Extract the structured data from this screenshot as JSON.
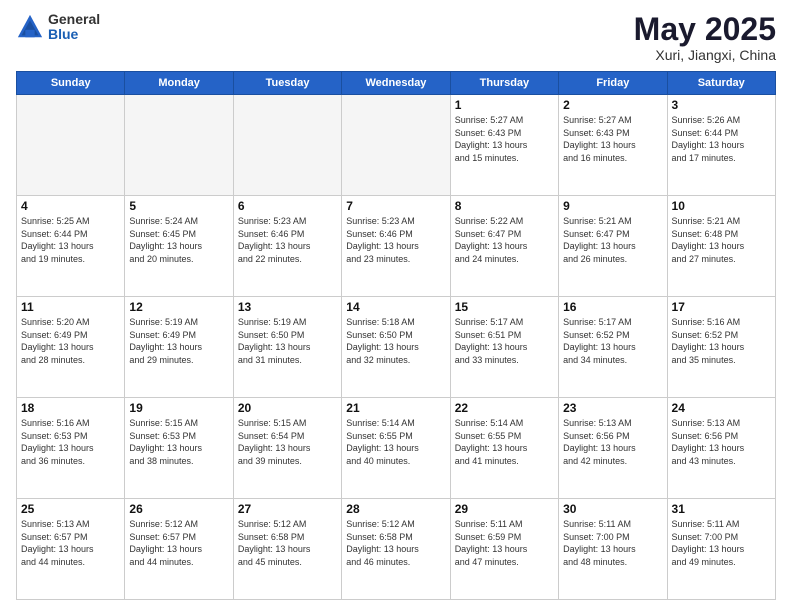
{
  "logo": {
    "general": "General",
    "blue": "Blue"
  },
  "title": "May 2025",
  "location": "Xuri, Jiangxi, China",
  "days_of_week": [
    "Sunday",
    "Monday",
    "Tuesday",
    "Wednesday",
    "Thursday",
    "Friday",
    "Saturday"
  ],
  "weeks": [
    [
      {
        "day": "",
        "info": ""
      },
      {
        "day": "",
        "info": ""
      },
      {
        "day": "",
        "info": ""
      },
      {
        "day": "",
        "info": ""
      },
      {
        "day": "1",
        "info": "Sunrise: 5:27 AM\nSunset: 6:43 PM\nDaylight: 13 hours\nand 15 minutes."
      },
      {
        "day": "2",
        "info": "Sunrise: 5:27 AM\nSunset: 6:43 PM\nDaylight: 13 hours\nand 16 minutes."
      },
      {
        "day": "3",
        "info": "Sunrise: 5:26 AM\nSunset: 6:44 PM\nDaylight: 13 hours\nand 17 minutes."
      }
    ],
    [
      {
        "day": "4",
        "info": "Sunrise: 5:25 AM\nSunset: 6:44 PM\nDaylight: 13 hours\nand 19 minutes."
      },
      {
        "day": "5",
        "info": "Sunrise: 5:24 AM\nSunset: 6:45 PM\nDaylight: 13 hours\nand 20 minutes."
      },
      {
        "day": "6",
        "info": "Sunrise: 5:23 AM\nSunset: 6:46 PM\nDaylight: 13 hours\nand 22 minutes."
      },
      {
        "day": "7",
        "info": "Sunrise: 5:23 AM\nSunset: 6:46 PM\nDaylight: 13 hours\nand 23 minutes."
      },
      {
        "day": "8",
        "info": "Sunrise: 5:22 AM\nSunset: 6:47 PM\nDaylight: 13 hours\nand 24 minutes."
      },
      {
        "day": "9",
        "info": "Sunrise: 5:21 AM\nSunset: 6:47 PM\nDaylight: 13 hours\nand 26 minutes."
      },
      {
        "day": "10",
        "info": "Sunrise: 5:21 AM\nSunset: 6:48 PM\nDaylight: 13 hours\nand 27 minutes."
      }
    ],
    [
      {
        "day": "11",
        "info": "Sunrise: 5:20 AM\nSunset: 6:49 PM\nDaylight: 13 hours\nand 28 minutes."
      },
      {
        "day": "12",
        "info": "Sunrise: 5:19 AM\nSunset: 6:49 PM\nDaylight: 13 hours\nand 29 minutes."
      },
      {
        "day": "13",
        "info": "Sunrise: 5:19 AM\nSunset: 6:50 PM\nDaylight: 13 hours\nand 31 minutes."
      },
      {
        "day": "14",
        "info": "Sunrise: 5:18 AM\nSunset: 6:50 PM\nDaylight: 13 hours\nand 32 minutes."
      },
      {
        "day": "15",
        "info": "Sunrise: 5:17 AM\nSunset: 6:51 PM\nDaylight: 13 hours\nand 33 minutes."
      },
      {
        "day": "16",
        "info": "Sunrise: 5:17 AM\nSunset: 6:52 PM\nDaylight: 13 hours\nand 34 minutes."
      },
      {
        "day": "17",
        "info": "Sunrise: 5:16 AM\nSunset: 6:52 PM\nDaylight: 13 hours\nand 35 minutes."
      }
    ],
    [
      {
        "day": "18",
        "info": "Sunrise: 5:16 AM\nSunset: 6:53 PM\nDaylight: 13 hours\nand 36 minutes."
      },
      {
        "day": "19",
        "info": "Sunrise: 5:15 AM\nSunset: 6:53 PM\nDaylight: 13 hours\nand 38 minutes."
      },
      {
        "day": "20",
        "info": "Sunrise: 5:15 AM\nSunset: 6:54 PM\nDaylight: 13 hours\nand 39 minutes."
      },
      {
        "day": "21",
        "info": "Sunrise: 5:14 AM\nSunset: 6:55 PM\nDaylight: 13 hours\nand 40 minutes."
      },
      {
        "day": "22",
        "info": "Sunrise: 5:14 AM\nSunset: 6:55 PM\nDaylight: 13 hours\nand 41 minutes."
      },
      {
        "day": "23",
        "info": "Sunrise: 5:13 AM\nSunset: 6:56 PM\nDaylight: 13 hours\nand 42 minutes."
      },
      {
        "day": "24",
        "info": "Sunrise: 5:13 AM\nSunset: 6:56 PM\nDaylight: 13 hours\nand 43 minutes."
      }
    ],
    [
      {
        "day": "25",
        "info": "Sunrise: 5:13 AM\nSunset: 6:57 PM\nDaylight: 13 hours\nand 44 minutes."
      },
      {
        "day": "26",
        "info": "Sunrise: 5:12 AM\nSunset: 6:57 PM\nDaylight: 13 hours\nand 44 minutes."
      },
      {
        "day": "27",
        "info": "Sunrise: 5:12 AM\nSunset: 6:58 PM\nDaylight: 13 hours\nand 45 minutes."
      },
      {
        "day": "28",
        "info": "Sunrise: 5:12 AM\nSunset: 6:58 PM\nDaylight: 13 hours\nand 46 minutes."
      },
      {
        "day": "29",
        "info": "Sunrise: 5:11 AM\nSunset: 6:59 PM\nDaylight: 13 hours\nand 47 minutes."
      },
      {
        "day": "30",
        "info": "Sunrise: 5:11 AM\nSunset: 7:00 PM\nDaylight: 13 hours\nand 48 minutes."
      },
      {
        "day": "31",
        "info": "Sunrise: 5:11 AM\nSunset: 7:00 PM\nDaylight: 13 hours\nand 49 minutes."
      }
    ]
  ]
}
